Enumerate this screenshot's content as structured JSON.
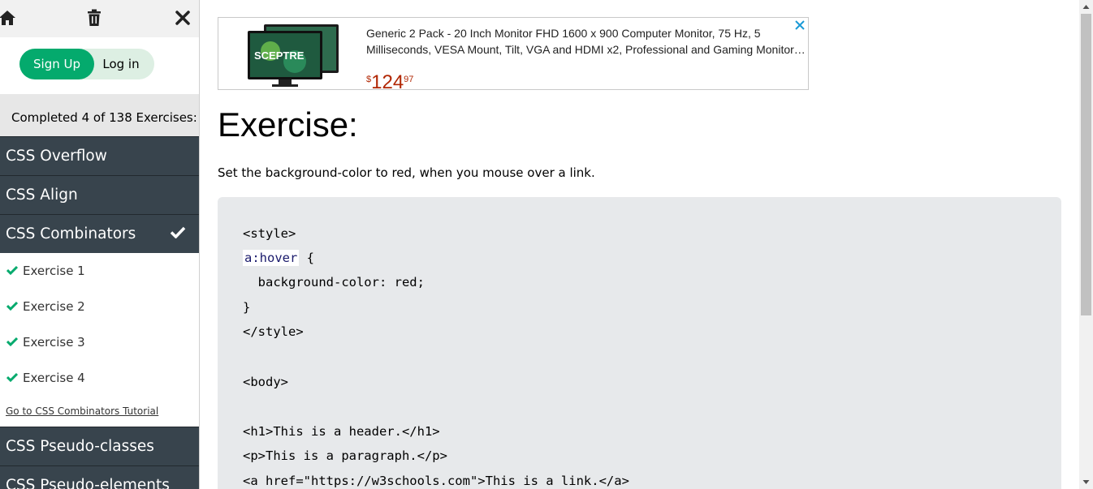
{
  "sidebar": {
    "auth": {
      "signup_label": "Sign Up",
      "login_label": "Log in"
    },
    "completed_text": "Completed 4 of 138 Exercises:",
    "categories_before": [
      "CSS Overflow",
      "CSS Align"
    ],
    "active_category": "CSS Combinators",
    "exercises": [
      "Exercise 1",
      "Exercise 2",
      "Exercise 3",
      "Exercise 4"
    ],
    "tutorial_link": "Go to CSS Combinators Tutorial",
    "categories_after": [
      "CSS Pseudo-classes",
      "CSS Pseudo-elements"
    ]
  },
  "ad": {
    "brand": "SCEPTRE",
    "title": "Generic 2 Pack - 20 Inch Monitor FHD 1600 x 900 Computer Monitor, 75 Hz, 5 Milliseconds, VESA Mount, Tilt, VGA and HDMI x2, Professional and Gaming Monitor…",
    "price_currency": "$",
    "price_main": "124",
    "price_cents": "97"
  },
  "exercise": {
    "heading": "Exercise:",
    "instruction": "Set the background-color to red, when you mouse over a link.",
    "code": {
      "line1": "<style>",
      "answer": "a:hover",
      "line2_rest": " {",
      "line3": "  background-color: red;",
      "line4": "}",
      "line5": "</style>",
      "line6": "<body>",
      "line7": "<h1>This is a header.</h1>",
      "line8": "<p>This is a paragraph.</p>",
      "line9": "<a href=\"https://w3schools.com\">This is a link.</a>"
    }
  },
  "colors": {
    "accent": "#04aa6d",
    "sidebar_dark": "#38444d",
    "code_bg": "#e7e9eb",
    "price": "#b12704"
  }
}
